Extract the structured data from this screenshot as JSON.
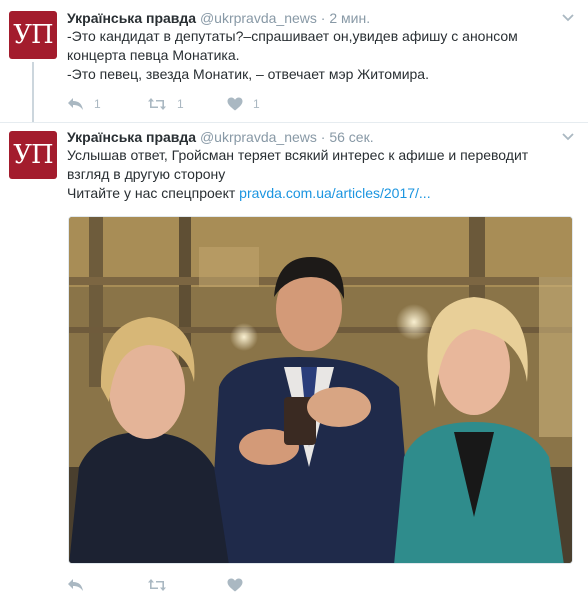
{
  "tweets": [
    {
      "author": "Українська правда",
      "handle": "@ukrpravda_news",
      "separator": "·",
      "time": "2 мин.",
      "avatar_text": "УП",
      "lines": [
        "-Это кандидат в депутаты?–спрашивает он,увидев афишу с анонсом",
        "концерта певца Монатика.",
        "-Это певец, звезда Монатик, – отвечает мэр Житомира."
      ],
      "actions": {
        "reply": "1",
        "retweet": "1",
        "like": "1"
      }
    },
    {
      "author": "Українська правда",
      "handle": "@ukrpravda_news",
      "separator": "·",
      "time": "56 сек.",
      "avatar_text": "УП",
      "lines": [
        "Услышав ответ, Гройсман теряет всякий интерес к афише и переводит",
        "взгляд в другую сторону"
      ],
      "link_prefix": "Читайте у нас спецпроект ",
      "link_text": "pravda.com.ua/articles/2017/...",
      "actions": {
        "reply": "",
        "retweet": "",
        "like": ""
      }
    }
  ],
  "icons": {
    "reply": "reply-icon",
    "retweet": "retweet-icon",
    "like": "heart-icon",
    "more": "chevron-down-icon"
  },
  "colors": {
    "avatar_bg": "#a31c2d",
    "link": "#1b95e0",
    "muted": "#8899a6",
    "action_icon": "#aab8c2"
  }
}
